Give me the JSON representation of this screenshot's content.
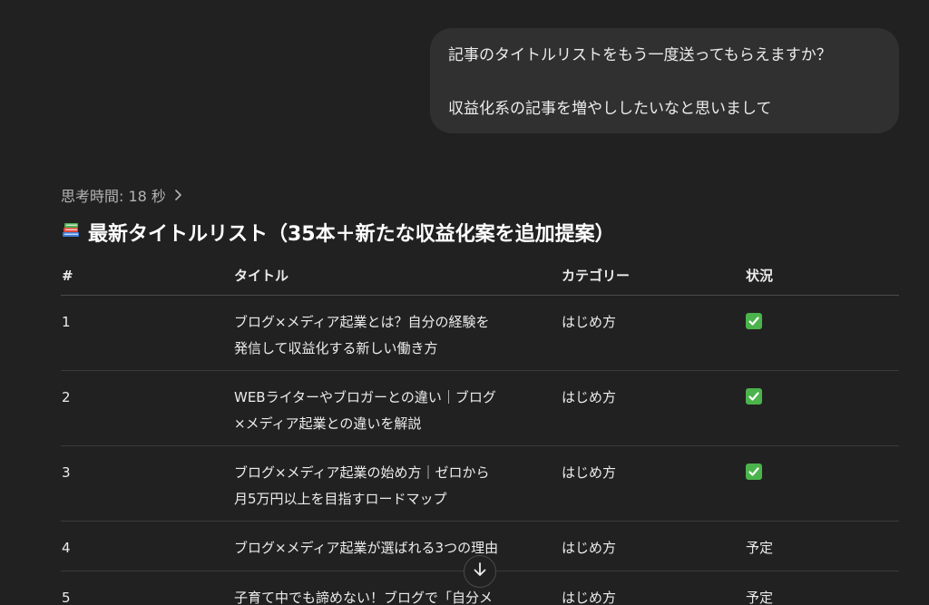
{
  "user_message": {
    "line1": "記事のタイトルリストをもう一度送ってもらえますか？",
    "line2": "収益化系の記事を増やししたいなと思いまして"
  },
  "thinking": {
    "label": "思考時間: 18 秒"
  },
  "response": {
    "heading": "最新タイトルリスト（35本＋新たな収益化案を追加提案）",
    "heading_icon": "books-icon",
    "table": {
      "headers": [
        "#",
        "タイトル",
        "カテゴリー",
        "状況"
      ],
      "rows": [
        {
          "num": "1",
          "title_line1": "ブログ×メディア起業とは？自分の経験を",
          "title_line2": "発信して収益化する新しい働き方",
          "category": "はじめ方",
          "status": "check"
        },
        {
          "num": "2",
          "title_line1": "WEBライターやブロガーとの違い｜ブログ",
          "title_line2": "×メディア起業との違いを解説",
          "category": "はじめ方",
          "status": "check"
        },
        {
          "num": "3",
          "title_line1": "ブログ×メディア起業の始め方｜ゼロから",
          "title_line2": "月5万円以上を目指すロードマップ",
          "category": "はじめ方",
          "status": "check"
        },
        {
          "num": "4",
          "title_line1": "ブログ×メディア起業が選ばれる3つの理由",
          "title_line2": "",
          "category": "はじめ方",
          "status": "予定"
        },
        {
          "num": "5",
          "title_line1": "子育て中でも諦めない！ブログで「自分メ",
          "title_line2": "",
          "category": "はじめ方",
          "status": "予定"
        }
      ]
    }
  },
  "colors": {
    "background": "#212121",
    "bubble": "#303030",
    "check_green": "#4bb34b"
  }
}
